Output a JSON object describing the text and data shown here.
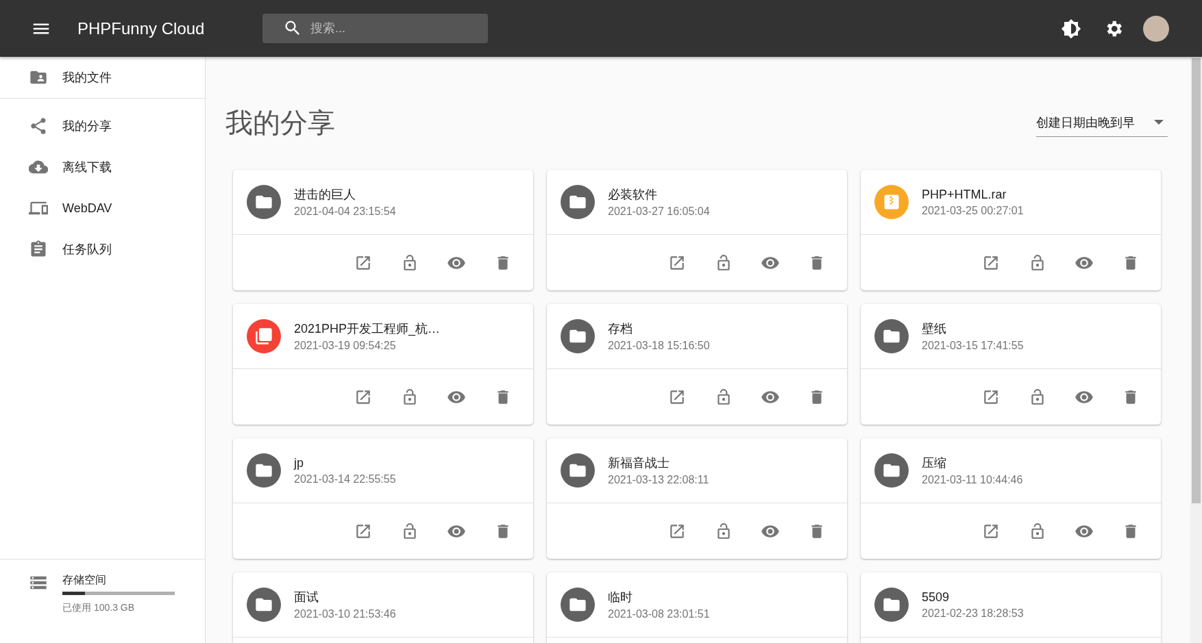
{
  "app_bar": {
    "title": "PHPFunny Cloud",
    "search": {
      "placeholder": "搜索..."
    }
  },
  "sidebar": {
    "items": [
      {
        "label": "我的文件",
        "selected": false
      },
      {
        "label": "我的分享",
        "selected": false
      },
      {
        "label": "离线下载",
        "selected": false
      },
      {
        "label": "WebDAV",
        "selected": false
      },
      {
        "label": "任务队列",
        "selected": false
      }
    ],
    "storage": {
      "label": "存储空间",
      "level": 0.2,
      "usage": "已使用 100.3 GB"
    }
  },
  "page": {
    "title": "我的分享",
    "sort": "创建日期由晚到早"
  },
  "shares": [
    {
      "kind": "folder",
      "name": "进击的巨人",
      "date": "2021-04-04 23:15:54"
    },
    {
      "kind": "folder",
      "name": "必装软件",
      "date": "2021-03-27 16:05:04"
    },
    {
      "kind": "archive",
      "name": "PHP+HTML.rar",
      "date": "2021-03-25 00:27:01"
    },
    {
      "kind": "pdf",
      "name": "2021PHP开发工程师_杭…",
      "date": "2021-03-19 09:54:25"
    },
    {
      "kind": "folder",
      "name": "存档",
      "date": "2021-03-18 15:16:50"
    },
    {
      "kind": "folder",
      "name": "壁纸",
      "date": "2021-03-15 17:41:55"
    },
    {
      "kind": "folder",
      "name": "jp",
      "date": "2021-03-14 22:55:55"
    },
    {
      "kind": "folder",
      "name": "新福音战士",
      "date": "2021-03-13 22:08:11"
    },
    {
      "kind": "folder",
      "name": "压缩",
      "date": "2021-03-11 10:44:46"
    },
    {
      "kind": "folder",
      "name": "面试",
      "date": "2021-03-10 21:53:46"
    },
    {
      "kind": "folder",
      "name": "临时",
      "date": "2021-03-08 23:01:51"
    },
    {
      "kind": "folder",
      "name": "5509",
      "date": "2021-02-23 18:28:53"
    }
  ]
}
